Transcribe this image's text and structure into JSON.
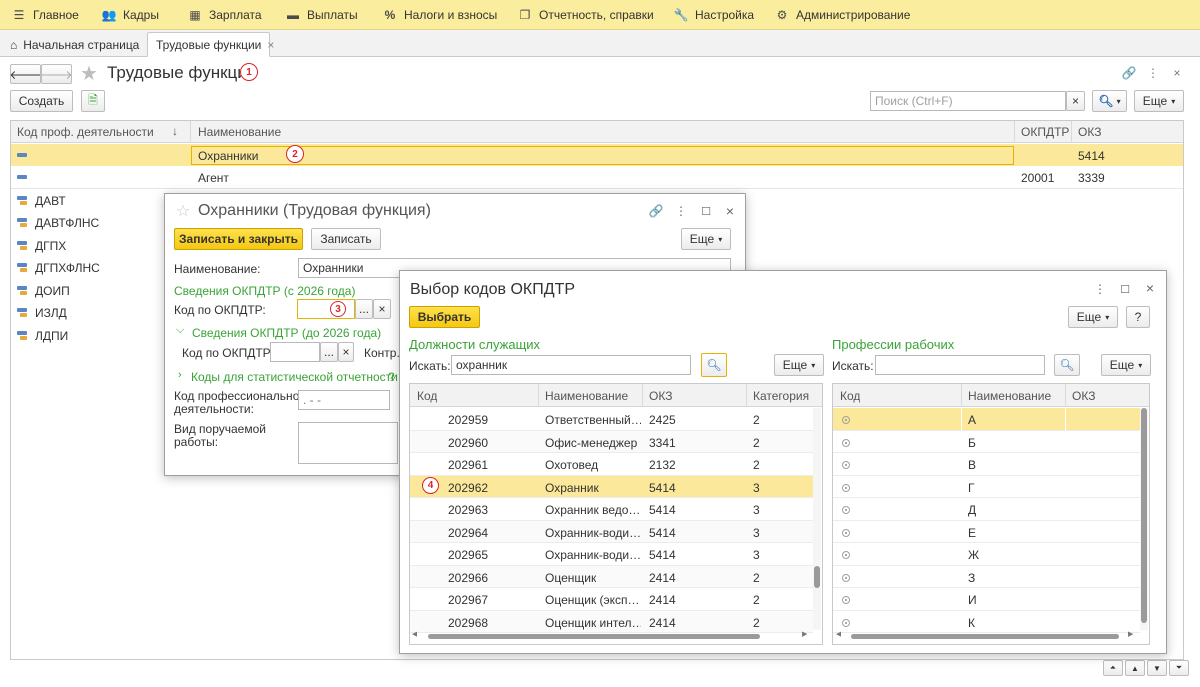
{
  "menu": [
    {
      "label": "Главное",
      "icon": "hamburger-icon"
    },
    {
      "label": "Кадры",
      "icon": "people-icon"
    },
    {
      "label": "Зарплата",
      "icon": "calculator-icon"
    },
    {
      "label": "Выплаты",
      "icon": "wallet-icon"
    },
    {
      "label": "Налоги и взносы",
      "icon": "percent-icon"
    },
    {
      "label": "Отчетность, справки",
      "icon": "copy-icon"
    },
    {
      "label": "Настройка",
      "icon": "wrench-icon"
    },
    {
      "label": "Администрирование",
      "icon": "gear-icon"
    }
  ],
  "tabs": {
    "home": "Начальная страница",
    "active": "Трудовые функции"
  },
  "page": {
    "title": "Трудовые функции"
  },
  "toolbar": {
    "create": "Создать",
    "search_placeholder": "Поиск (Ctrl+F)",
    "more": "Еще"
  },
  "list": {
    "columns": [
      "Код проф. деятельности",
      "Наименование",
      "ОКПДТР",
      "ОКЗ"
    ],
    "rows": [
      {
        "code": "",
        "name": "Охранники",
        "okpdtr": "",
        "okz": "5414"
      },
      {
        "code": "",
        "name": "Агент",
        "okpdtr": "20001",
        "okz": "3339"
      }
    ],
    "groups": [
      "ДАВТ",
      "ДАВТФЛНС",
      "ДГПХ",
      "ДГПХФЛНС",
      "ДОИП",
      "ИЗЛД",
      "ЛДПИ"
    ]
  },
  "form": {
    "title": "Охранники (Трудовая функция)",
    "save_close": "Записать и закрыть",
    "save": "Записать",
    "more": "Еще",
    "name_label": "Наименование:",
    "name_value": "Охранники",
    "section_2026": "Сведения ОКПДТР (с 2026 года)",
    "code_label": "Код по ОКПДТР:",
    "section_before": "Сведения ОКПДТР (до 2026 года)",
    "code_label2": "Код по ОКПДТР:",
    "contr_label": "Контр.",
    "stats_section": "Коды для статистической отчетности",
    "help": "?",
    "prof_code_label_1": "Код профессиональной",
    "prof_code_label_2": "деятельности:",
    "prof_code_mask": ". - -",
    "work_label_1": "Вид поручаемой",
    "work_label_2": "работы:"
  },
  "picker": {
    "title": "Выбор кодов ОКПДТР",
    "select": "Выбрать",
    "more": "Еще",
    "help": "?",
    "left": {
      "heading": "Должности служащих",
      "search_label": "Искать:",
      "search_value": "охранник",
      "more": "Еще",
      "columns": [
        "Код",
        "Наименование",
        "ОКЗ",
        "Категория"
      ],
      "rows": [
        [
          "202959",
          "Ответственный…",
          "2425",
          "2"
        ],
        [
          "202960",
          "Офис-менеджер",
          "3341",
          "2"
        ],
        [
          "202961",
          "Охотовед",
          "2132",
          "2"
        ],
        [
          "202962",
          "Охранник",
          "5414",
          "3"
        ],
        [
          "202963",
          "Охранник ведо…",
          "5414",
          "3"
        ],
        [
          "202964",
          "Охранник-води…",
          "5414",
          "3"
        ],
        [
          "202965",
          "Охранник-води…",
          "5414",
          "3"
        ],
        [
          "202966",
          "Оценщик",
          "2414",
          "2"
        ],
        [
          "202967",
          "Оценщик (эксп…",
          "2414",
          "2"
        ],
        [
          "202968",
          "Оценщик интел…",
          "2414",
          "2"
        ]
      ],
      "selected_index": 3
    },
    "right": {
      "heading": "Профессии рабочих",
      "search_label": "Искать:",
      "search_value": "",
      "more": "Еще",
      "columns": [
        "Код",
        "Наименование",
        "ОКЗ"
      ],
      "rows": [
        "А",
        "Б",
        "В",
        "Г",
        "Д",
        "Е",
        "Ж",
        "З",
        "И",
        "К"
      ],
      "selected_index": 0
    }
  },
  "badges": [
    "1",
    "2",
    "3",
    "4"
  ],
  "colors": {
    "menu_bg": "#fbed9e",
    "selected_row": "#fce89a",
    "accent_yellow": "#f5c812",
    "green": "#3aa337",
    "badge_red": "#d9242b"
  }
}
